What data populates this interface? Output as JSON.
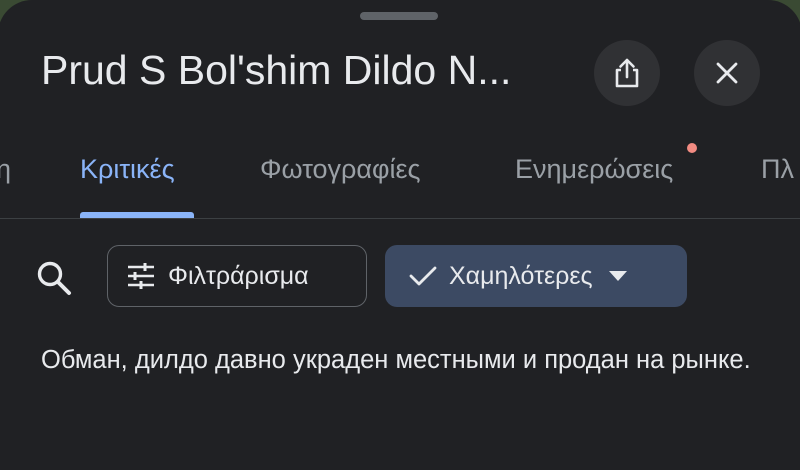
{
  "header": {
    "title": "Prud S Bol'shim Dildo N..."
  },
  "tabs": [
    {
      "label": "η"
    },
    {
      "label": "Κριτικές",
      "active": true
    },
    {
      "label": "Φωτογραφίες"
    },
    {
      "label": "Ενημερώσεις",
      "has_notification": true
    },
    {
      "label": "Πλ"
    }
  ],
  "toolbar": {
    "filter_label": "Φιλτράρισμα",
    "sort_label": "Χαμηλότερες"
  },
  "reviews": [
    {
      "text": "Обман, дилдо давно украден местными и продан на рынке."
    }
  ],
  "colors": {
    "background": "#202124",
    "accent": "#8ab4f8",
    "sort_chip": "#3c4a63",
    "notification_dot": "#f28b82"
  },
  "icons": [
    "share-icon",
    "close-icon",
    "search-icon",
    "filter-sliders-icon",
    "check-icon",
    "caret-down-icon"
  ]
}
